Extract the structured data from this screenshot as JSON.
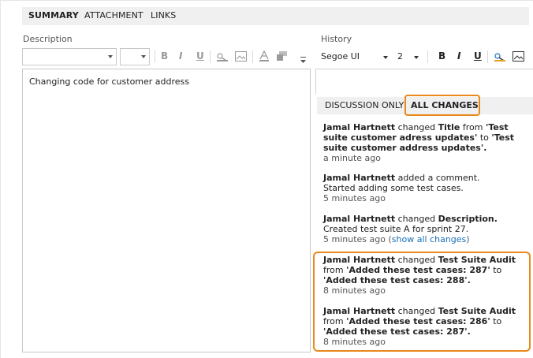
{
  "tabs": [
    "SUMMARY",
    "ATTACHMENT",
    "LINKS"
  ],
  "description_label": "Description",
  "history_label": "History",
  "description_text": "Changing code for customer address",
  "right_toolbar": {
    "font": "Segoe UI",
    "size": "2"
  },
  "filters": [
    "DISCUSSION ONLY",
    "ALL CHANGES"
  ],
  "accent_color": "#e8891a",
  "link_color": "#1a6fb7",
  "history": [
    {
      "author": "Jamal Hartnett",
      "verb": "changed",
      "field": "Title",
      "from": "'Test suite customer adress updates'",
      "to": "'Test suite customer address updates'.",
      "time": "a minute ago"
    },
    {
      "author": "Jamal Hartnett",
      "verb": "added a comment.",
      "comment": "Started adding some test cases.",
      "time": "5 minutes ago"
    },
    {
      "author": "Jamal Hartnett",
      "verb": "changed",
      "field": "Description.",
      "comment": "Created test suite A for sprint 27.",
      "time": "5 minutes ago",
      "link": "show all changes"
    },
    {
      "author": "Jamal Hartnett",
      "verb": "changed",
      "field": "Test Suite Audit",
      "from": "'Added these test cases: 287'",
      "to": "'Added these test cases: 288'.",
      "time": "8 minutes ago"
    },
    {
      "author": "Jamal Hartnett",
      "verb": "changed",
      "field": "Test Suite Audit",
      "from": "'Added these test cases: 286'",
      "to": "'Added these test cases: 287'.",
      "time": "8 minutes ago"
    }
  ]
}
